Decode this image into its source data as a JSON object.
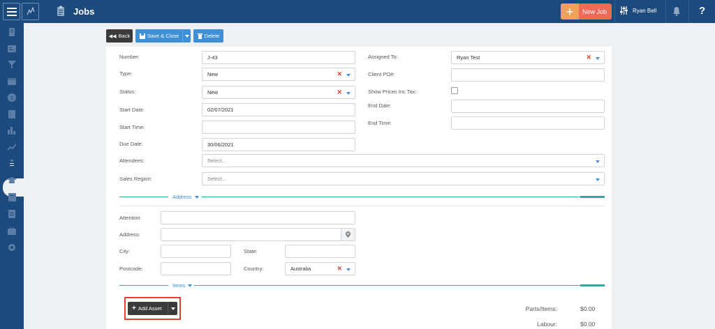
{
  "app": {
    "title": "Jobs"
  },
  "header": {
    "new_job_label": "New Job",
    "user_name": "Ryan Bell",
    "help_label": "?"
  },
  "toolbar": {
    "back_label": "Back",
    "save_label": "Save & Close",
    "delete_label": "Delete"
  },
  "form": {
    "number": {
      "label": "Number:",
      "value": "J-43"
    },
    "type": {
      "label": "Type:",
      "value": "New"
    },
    "status": {
      "label": "Status:",
      "value": "New"
    },
    "start_date": {
      "label": "Start Date:",
      "value": "02/07/2021"
    },
    "start_time": {
      "label": "Start Time:",
      "value": ""
    },
    "due_date": {
      "label": "Due Date:",
      "value": "30/06/2021"
    },
    "assigned_to": {
      "label": "Assigned To:",
      "value": "Ryan Test"
    },
    "client_po": {
      "label": "Client PO#:",
      "value": ""
    },
    "show_prices": {
      "label": "Show Prices Inc Tax:",
      "checked": false
    },
    "end_date": {
      "label": "End Date:",
      "value": ""
    },
    "end_time": {
      "label": "End Time:",
      "value": ""
    },
    "attendees": {
      "label": "Attendees:",
      "placeholder": "Select..."
    },
    "sales_region": {
      "label": "Sales Region:",
      "placeholder": "Select..."
    }
  },
  "address": {
    "section_title": "Address",
    "attention": {
      "label": "Attention:",
      "value": ""
    },
    "address": {
      "label": "Address:",
      "value": ""
    },
    "city": {
      "label": "City:",
      "value": ""
    },
    "state": {
      "label": "State:",
      "value": ""
    },
    "postcode": {
      "label": "Postcode:",
      "value": ""
    },
    "country": {
      "label": "Country:",
      "value": "Australia"
    }
  },
  "items": {
    "section_title": "Items",
    "add_asset_label": "Add Asset"
  },
  "totals": {
    "parts_label": "Parts/Items:",
    "parts_value": "$0.00",
    "labour_label": "Labour:",
    "labour_value": "$0.00"
  },
  "colors": {
    "topbar": "#1c4a7d",
    "accent_blue": "#3e8fd5",
    "new_job": "#ee6a57",
    "section_line": "#37a79a",
    "highlight": "#e2412c"
  }
}
